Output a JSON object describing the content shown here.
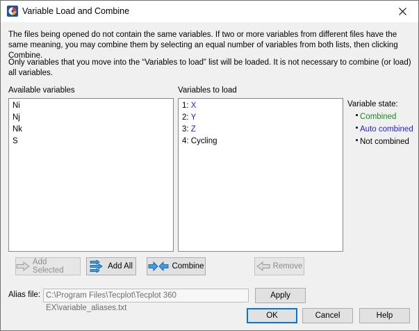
{
  "window": {
    "title": "Variable Load and Combine"
  },
  "description": {
    "p1": "The files being opened do not contain the same variables. If two or more variables from different files have the same meaning, you may combine them by selecting an equal number of variables from both lists, then clicking Combine.",
    "p2": "Only variables that you move into the “Variables to load” list will be loaded. It is not necessary to combine (or load) all variables."
  },
  "available": {
    "label": "Available variables",
    "items": [
      "Ni",
      "Nj",
      "Nk",
      "S"
    ]
  },
  "to_load": {
    "label": "Variables to load",
    "items": [
      {
        "num": "1:",
        "name": "X",
        "state": "auto"
      },
      {
        "num": "2:",
        "name": "Y",
        "state": "auto"
      },
      {
        "num": "3:",
        "name": "Z",
        "state": "auto"
      },
      {
        "num": "4:",
        "name": "Cycling",
        "state": "none"
      }
    ]
  },
  "legend": {
    "title": "Variable state:",
    "combined": "Combined",
    "auto_combined": "Auto combined",
    "not_combined": "Not combined"
  },
  "buttons": {
    "add_selected": "Add Selected",
    "add_all": "Add All",
    "combine": "Combine",
    "remove": "Remove",
    "apply": "Apply",
    "ok": "OK",
    "cancel": "Cancel",
    "help": "Help"
  },
  "alias": {
    "label": "Alias file:",
    "value": "C:\\Program Files\\Tecplot\\Tecplot 360 EX\\variable_aliases.txt"
  },
  "colors": {
    "combined": "#1a8a1a",
    "auto_combined": "#1f1fd0",
    "accent": "#0078d7"
  }
}
